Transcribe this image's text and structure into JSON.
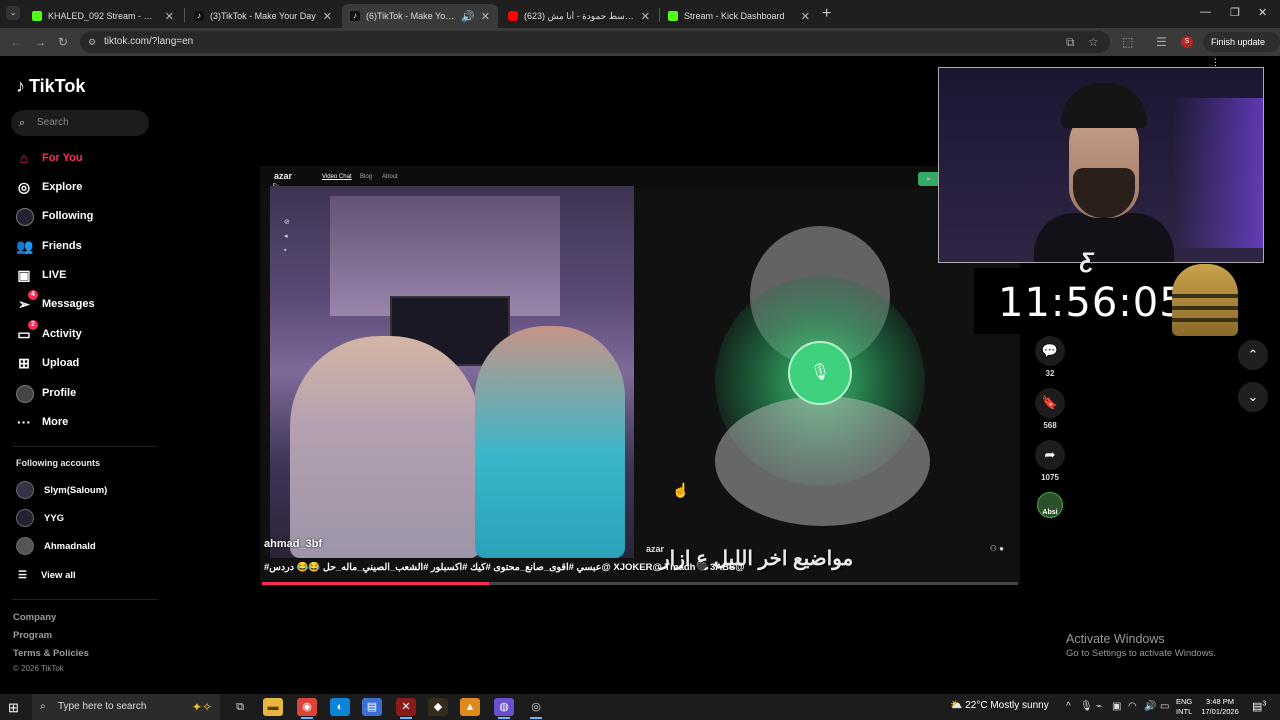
{
  "browser": {
    "tabs": [
      {
        "title": "KHALED_092 Stream - Watch Li",
        "color": "#53fc18",
        "active": false
      },
      {
        "title": "(3)TikTok - Make Your Day",
        "color": "#111111",
        "active": false
      },
      {
        "title": "(6)TikTok - Make Your Day",
        "color": "#111111",
        "active": true
      },
      {
        "title": "عبد الباسط حمودة - أنا مش (623)",
        "color": "#ff0000",
        "active": false
      },
      {
        "title": "Stream - Kick Dashboard",
        "color": "#53fc18",
        "active": false
      }
    ],
    "url": "tiktok.com/?lang=en",
    "finish_update": "Finish update",
    "profile_initial": "S"
  },
  "tiktok": {
    "logo": "TikTok",
    "search_placeholder": "Search",
    "nav": [
      {
        "label": "For You",
        "icon": "home-icon",
        "active": true
      },
      {
        "label": "Explore",
        "icon": "compass-icon",
        "active": false
      },
      {
        "label": "Following",
        "icon": "following-avatar-icon",
        "active": false
      },
      {
        "label": "Friends",
        "icon": "friends-icon",
        "active": false
      },
      {
        "label": "LIVE",
        "icon": "live-icon",
        "active": false
      },
      {
        "label": "Messages",
        "icon": "messages-icon",
        "active": false,
        "badge": "4"
      },
      {
        "label": "Activity",
        "icon": "activity-icon",
        "active": false,
        "badge": "2"
      },
      {
        "label": "Upload",
        "icon": "upload-icon",
        "active": false
      },
      {
        "label": "Profile",
        "icon": "profile-icon",
        "active": false
      },
      {
        "label": "More",
        "icon": "more-icon",
        "active": false
      }
    ],
    "following_title": "Following accounts",
    "following_accounts": [
      "Slym(Saloum)",
      "YYG",
      "Ahmadnald"
    ],
    "view_all": "View all",
    "footer_links": [
      "Company",
      "Program",
      "Terms & Policies"
    ],
    "copyright": "© 2026 TikTok"
  },
  "video": {
    "author": "ahmad_3bf",
    "description": "#عبسي #اقوى_صانع_محتوى #كيك #اكسبلور #الشعب_الصيني_ماله_حل 😂😂 دردس@ XJOKER@ Tmadh🖤 3ABS@",
    "overlay_text": "مواضيع اخر الليل ع ازار",
    "azar_brand": "azar",
    "azar_links": [
      "Video Chat",
      "Blog",
      "About"
    ],
    "progress": 0.3,
    "comments": "32",
    "bookmarks": "568",
    "shares": "1075",
    "creator_avatar_label": "Absi"
  },
  "stream_overlay": {
    "timer": "11:56:05"
  },
  "windows": {
    "activate_title": "Activate Windows",
    "activate_sub": "Go to Settings to activate Windows.",
    "search_placeholder": "Type here to search",
    "weather": "22°C  Mostly sunny",
    "lang_top": "ENG",
    "lang_bottom": "INTL",
    "time": "3:48 PM",
    "date": "17/01/2026",
    "notifications": "3"
  }
}
